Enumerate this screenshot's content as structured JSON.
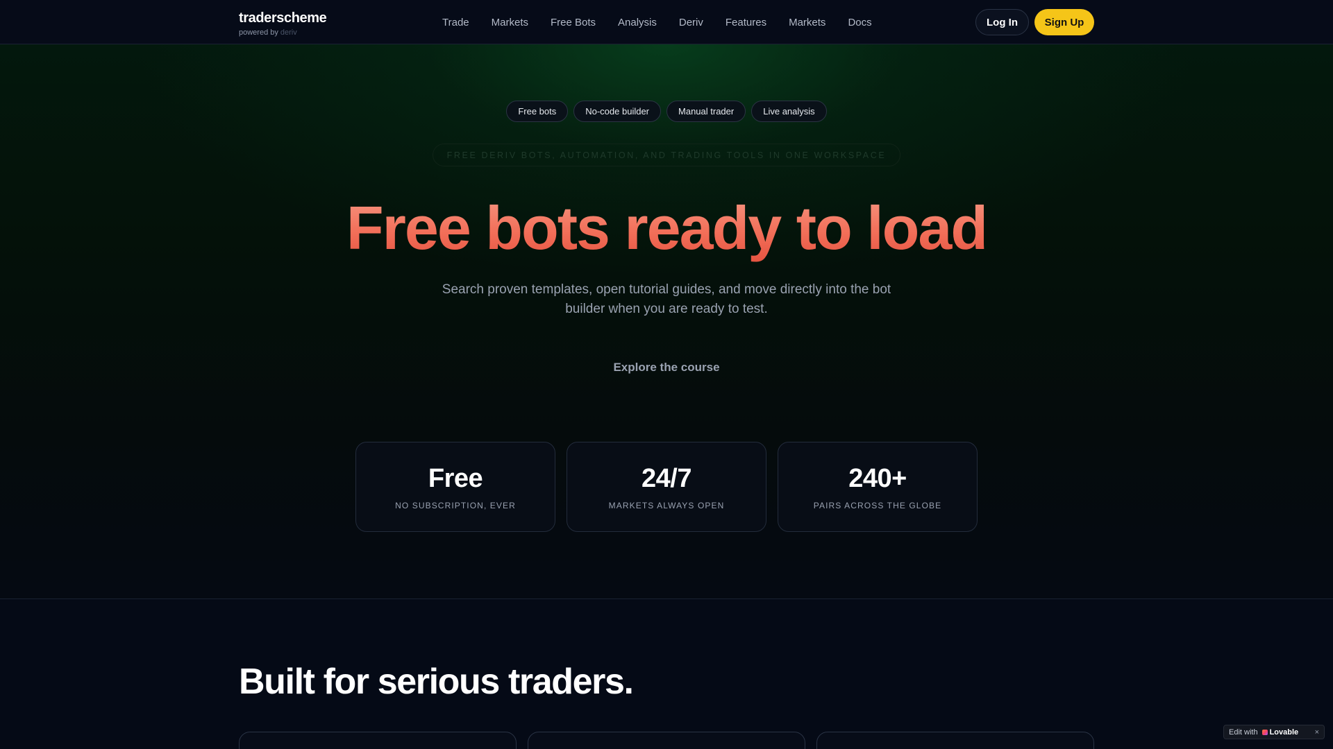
{
  "header": {
    "brand_name": "traderscheme",
    "brand_powered": "powered by",
    "brand_deriv": "deriv",
    "nav": [
      "Trade",
      "Markets",
      "Free Bots",
      "Analysis",
      "Deriv",
      "Features",
      "Markets",
      "Docs"
    ],
    "login_label": "Log In",
    "signup_label": "Sign Up"
  },
  "hero": {
    "chips": [
      "Free bots",
      "No-code builder",
      "Manual trader",
      "Live analysis"
    ],
    "tagline": "FREE DERIV BOTS, AUTOMATION, AND TRADING TOOLS IN ONE WORKSPACE",
    "headline": "Free bots ready to load",
    "subtext": "Search proven templates, open tutorial guides, and move directly into the bot builder when you are ready to test.",
    "explore_label": "Explore the course",
    "stats": [
      {
        "value": "Free",
        "label": "NO SUBSCRIPTION, EVER"
      },
      {
        "value": "24/7",
        "label": "MARKETS ALWAYS OPEN"
      },
      {
        "value": "240+",
        "label": "PAIRS ACROSS THE GLOBE"
      }
    ]
  },
  "features": {
    "title": "Built for serious traders."
  },
  "badge": {
    "edit_with": "Edit with",
    "brand": "Lovable",
    "close_glyph": "×"
  },
  "colors": {
    "background": "#050a16",
    "accent_yellow": "#f5c518",
    "headline_gradient_start": "#f79a86",
    "headline_gradient_end": "#e4503e",
    "hero_glow_green": "#0a5a28"
  }
}
